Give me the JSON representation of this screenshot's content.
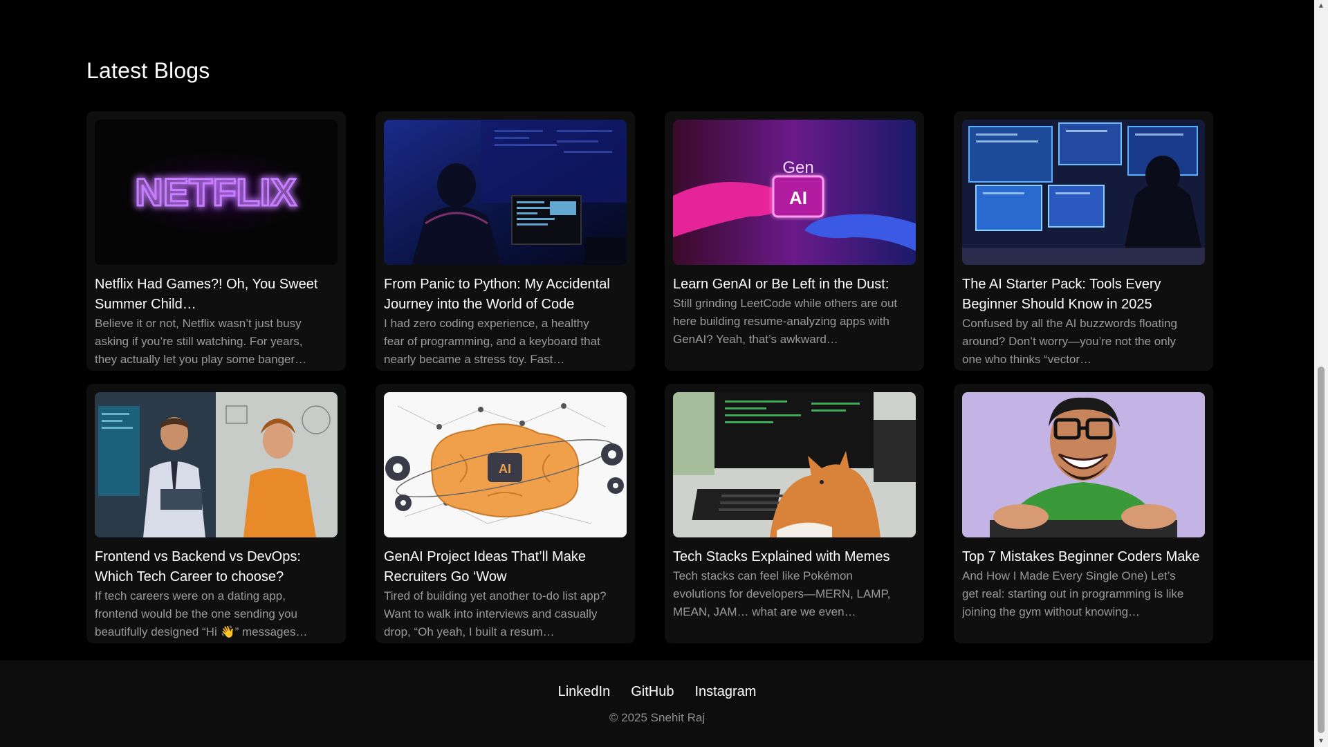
{
  "section": {
    "title": "Latest Blogs"
  },
  "blogs": [
    {
      "title": "Netflix Had Games?! Oh, You Sweet Summer Child…",
      "desc": "Believe it or not, Netflix wasn’t just busy asking if you’re still watching. For years, they actually let you play some banger…",
      "image": "netflix-neon-image",
      "image_text": "NETFLIX"
    },
    {
      "title": "From Panic to Python: My Accidental Journey into the World of Code",
      "desc": "I had zero coding experience, a healthy fear of programming, and a keyboard that nearly became a stress toy. Fast…",
      "image": "coder-at-desk-image"
    },
    {
      "title": "Learn GenAI or Be Left in the Dust:",
      "desc": "Still grinding LeetCode while others are out here building resume-analyzing apps with GenAI? Yeah, that’s awkward…",
      "image": "genai-hands-image",
      "image_text_top": "Gen",
      "image_text_box": "AI"
    },
    {
      "title": "The AI Starter Pack: Tools Every Beginner Should Know in 2025",
      "desc": "Confused by all the AI buzzwords floating around? Don’t worry—you’re not the only one who thinks “vector…",
      "image": "hacker-screens-image"
    },
    {
      "title": "Frontend vs Backend vs DevOps: Which Tech Career to choose?",
      "desc": "If tech careers were on a dating app, frontend would be the one sending you beautifully designed “Hi 👋” messages…",
      "image": "developers-illustration-image"
    },
    {
      "title": "GenAI Project Ideas That’ll Make Recruiters Go ‘Wow",
      "desc": "Tired of building yet another to-do list app? Want to walk into interviews and casually drop, “Oh yeah, I built a resum…",
      "image": "ai-brain-image",
      "image_text": "AI"
    },
    {
      "title": "Tech Stacks Explained with Memes",
      "desc": "Tech stacks can feel like Pokémon evolutions for developers—MERN, LAMP, MEAN, JAM… what are we even…",
      "image": "cat-at-keyboard-image"
    },
    {
      "title": "Top 7 Mistakes Beginner Coders Make",
      "desc": "And How I Made Every Single One) Let’s get real: starting out in programming is like joining the gym without knowing…",
      "image": "excited-man-keyboard-image"
    }
  ],
  "footer": {
    "links": [
      "LinkedIn",
      "GitHub",
      "Instagram"
    ],
    "copyright": "© 2025 Snehit Raj"
  },
  "colors": {
    "background": "#000000",
    "card": "#0f0f0f",
    "footer": "#0d0d0d",
    "muted_text": "#9a9a9a"
  }
}
